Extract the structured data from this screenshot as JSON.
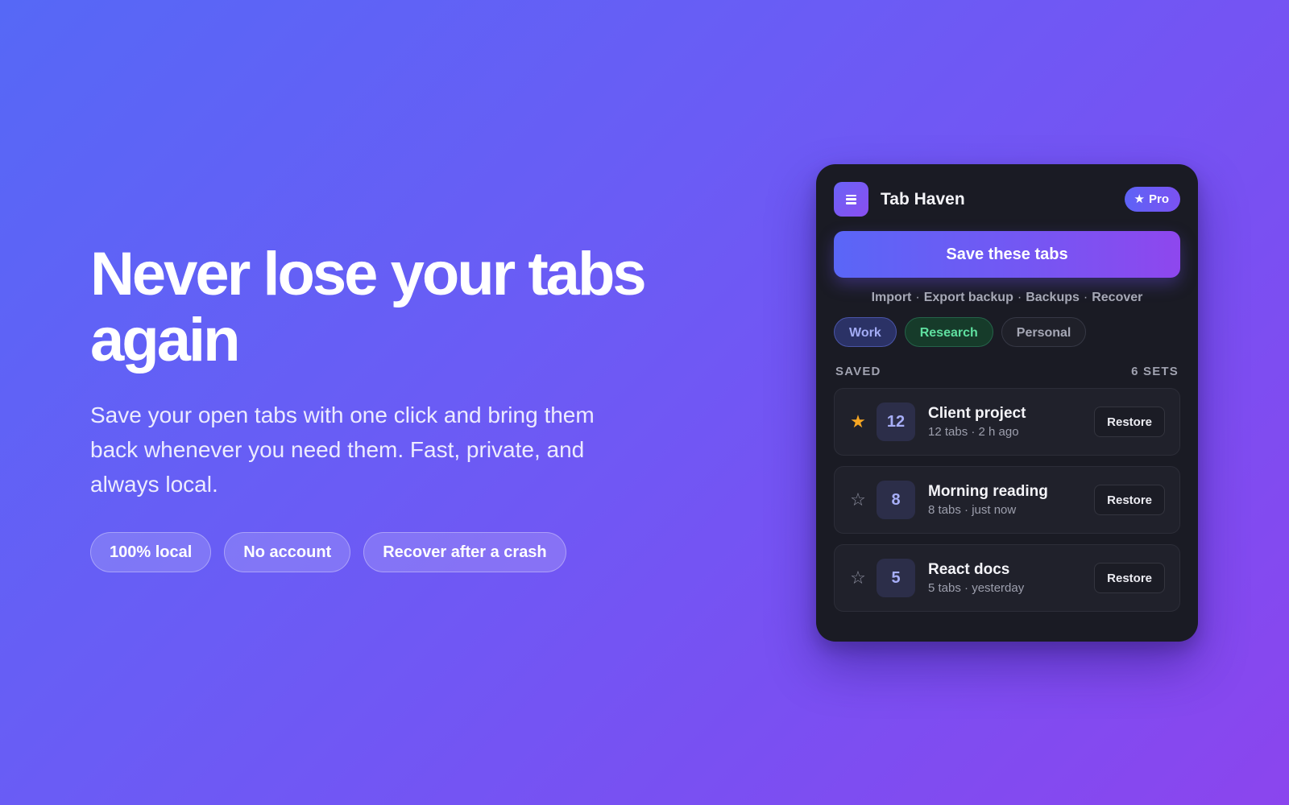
{
  "hero": {
    "title": "Never lose your tabs again",
    "subtitle": "Save your open tabs with one click and bring them back whenever you need them. Fast, private, and always local.",
    "pills": [
      "100% local",
      "No account",
      "Recover after a crash"
    ]
  },
  "popup": {
    "app_name": "Tab Haven",
    "logo_icon": "menu-lines-icon",
    "pro_badge": {
      "icon": "★",
      "label": "Pro"
    },
    "save_button": "Save these tabs",
    "links": [
      "Import",
      "Export backup",
      "Backups",
      "Recover"
    ],
    "link_separator": "·",
    "tags": [
      {
        "label": "Work",
        "color": "#a3acf5"
      },
      {
        "label": "Research",
        "color": "#5fe0a0"
      },
      {
        "label": "Personal",
        "color": "#a5a7b5"
      }
    ],
    "section": {
      "label": "SAVED",
      "count": "6 SETS"
    },
    "sets": [
      {
        "starred": true,
        "star_glyph": "★",
        "count": "12",
        "name": "Client project",
        "meta": "12 tabs · 2 h ago",
        "action": "Restore"
      },
      {
        "starred": false,
        "star_glyph": "☆",
        "count": "8",
        "name": "Morning reading",
        "meta": "8 tabs · just now",
        "action": "Restore"
      },
      {
        "starred": false,
        "star_glyph": "☆",
        "count": "5",
        "name": "React docs",
        "meta": "5 tabs · yesterday",
        "action": "Restore"
      }
    ]
  },
  "colors": {
    "accent": "#6a5cf5",
    "star_active": "#f5a623",
    "card_bg": "#1a1b24"
  }
}
